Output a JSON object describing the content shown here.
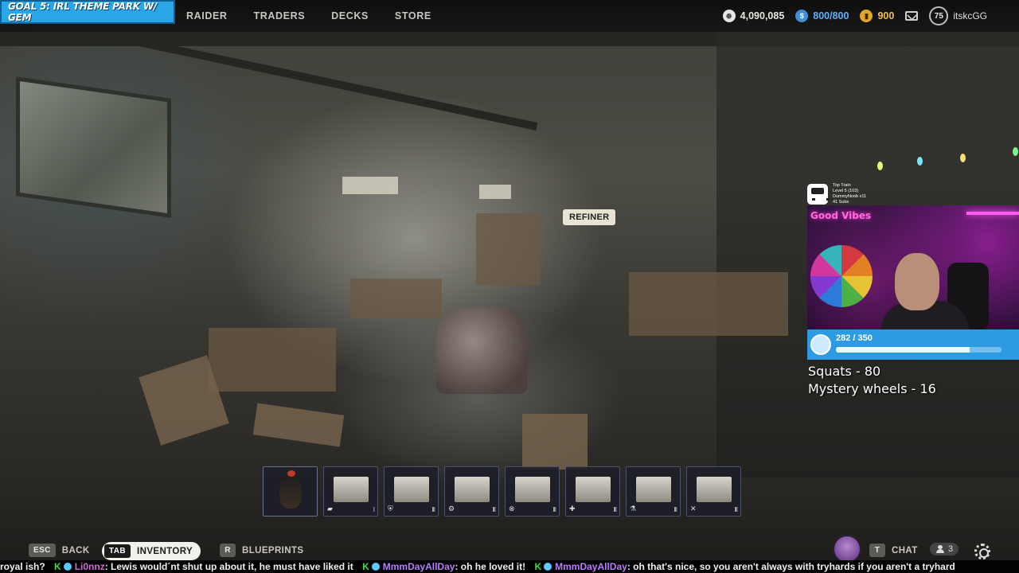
{
  "overlay": {
    "goal_banner": "GOAL 5: IRL THEME PARK W/ GEM",
    "train": {
      "title": "Top Train",
      "level": "Level 5 (103)",
      "top": "DummyNoob x11",
      "subs": "41 Subs"
    },
    "good_vibes": "Good Vibes",
    "progress": {
      "label": "282 / 350",
      "current": 282,
      "target": 350
    },
    "goal_lines": [
      "Squats - 80",
      "Mystery wheels - 16"
    ]
  },
  "nav": {
    "items": [
      "RAIDER",
      "TRADERS",
      "DECKS",
      "STORE"
    ]
  },
  "status": {
    "coins": "4,090,085",
    "tokens": "800/800",
    "gold": "900",
    "level": "75",
    "username": "itskcGG"
  },
  "scene": {
    "refiner_label": "REFINER"
  },
  "hotbar": {
    "slots": [
      {
        "name": "rooster",
        "badge": "",
        "rank": ""
      },
      {
        "name": "workbench-1",
        "badge": "▰",
        "rank": "I"
      },
      {
        "name": "workbench-2",
        "badge": "⛨",
        "rank": "III"
      },
      {
        "name": "workbench-3",
        "badge": "⚙",
        "rank": "III"
      },
      {
        "name": "workbench-4",
        "badge": "⊗",
        "rank": "III"
      },
      {
        "name": "workbench-5",
        "badge": "✚",
        "rank": "III"
      },
      {
        "name": "workbench-6",
        "badge": "⚗",
        "rank": "III"
      },
      {
        "name": "workbench-7",
        "badge": "✕",
        "rank": "III"
      }
    ]
  },
  "controls": {
    "back": {
      "key": "ESC",
      "label": "BACK"
    },
    "inventory": {
      "key": "TAB",
      "label": "INVENTORY"
    },
    "blueprints": {
      "key": "R",
      "label": "BLUEPRINTS"
    },
    "chat": {
      "key": "T",
      "label": "CHAT"
    },
    "friends_count": "3"
  },
  "ticker": {
    "lead": "royal ish?",
    "messages": [
      {
        "user": "Li0nnz",
        "text": ": Lewis would´nt shut up about it, he must have liked it"
      },
      {
        "user": "MmmDayAllDay",
        "text": ": oh he loved it!"
      },
      {
        "user": "MmmDayAllDay",
        "text": ": oh that's nice, so you aren't always with tryhards if you aren't a tryhard"
      }
    ]
  },
  "colors": {
    "accent_blue": "#2c9be3",
    "gold": "#f2c24a",
    "token_blue": "#5fb0ff",
    "kick_green": "#3dde3d"
  }
}
